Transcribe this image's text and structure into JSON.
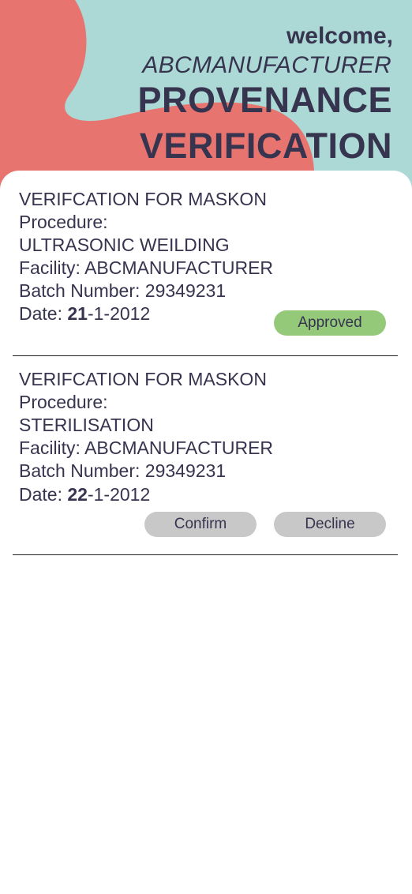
{
  "header": {
    "welcome": "welcome,",
    "username": "ABCMANUFACTURER",
    "title_line1": "PROVENANCE",
    "title_line2": "VERIFICATION"
  },
  "colors": {
    "header_teal": "#acd9d5",
    "header_coral": "#e8746f",
    "text_dark": "#36344f",
    "approved_green": "#94c97a",
    "button_grey": "#c8c8c8"
  },
  "verifications": [
    {
      "heading": "VERIFCATION FOR MASKON",
      "procedure_label": "Procedure:",
      "procedure": "ULTRASONIC WEILDING",
      "facility": "Facility: ABCMANUFACTURER",
      "batch": "Batch Number: 29349231",
      "date_label": "Date: ",
      "date_day": "21",
      "date_rest": "-1-2012",
      "status": "Approved"
    },
    {
      "heading": "VERIFCATION FOR MASKON",
      "procedure_label": "Procedure:",
      "procedure": "STERILISATION",
      "facility": "Facility: ABCMANUFACTURER",
      "batch": "Batch Number: 29349231",
      "date_label": "Date: ",
      "date_day": "22",
      "date_rest": "-1-2012",
      "confirm_label": "Confirm",
      "decline_label": "Decline"
    }
  ]
}
